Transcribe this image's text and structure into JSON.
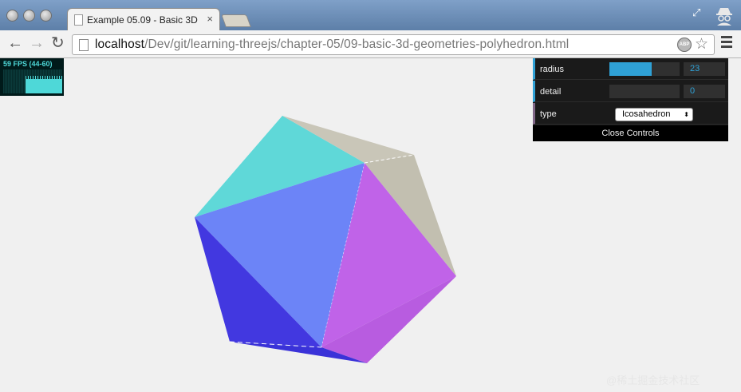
{
  "browser": {
    "tab_title": "Example 05.09 - Basic 3D",
    "tab_close": "×",
    "url_host": "localhost",
    "url_path": "/Dev/git/learning-threejs/chapter-05/09-basic-3d-geometries-polyhedron.html",
    "back_glyph": "←",
    "forward_glyph": "→",
    "reload_glyph": "↻",
    "adblock_label": "ABP",
    "bookmark_glyph": "☆",
    "resize_glyph": "⤢"
  },
  "stats": {
    "fps_text": "59 FPS (44-60)"
  },
  "controls": {
    "radius_label": "radius",
    "radius_value": "23",
    "radius_fraction": 0.6,
    "detail_label": "detail",
    "detail_value": "0",
    "type_label": "type",
    "type_value": "Icosahedron",
    "select_arrow": "⬍",
    "close_label": "Close Controls",
    "slider_color": "#2fa1d6"
  },
  "scene": {
    "face_colors": [
      "#5fd8d8",
      "#c9c6b8",
      "#6c84f7",
      "#c063e8",
      "#4238e0"
    ]
  },
  "watermark": "@稀土掘金技术社区"
}
